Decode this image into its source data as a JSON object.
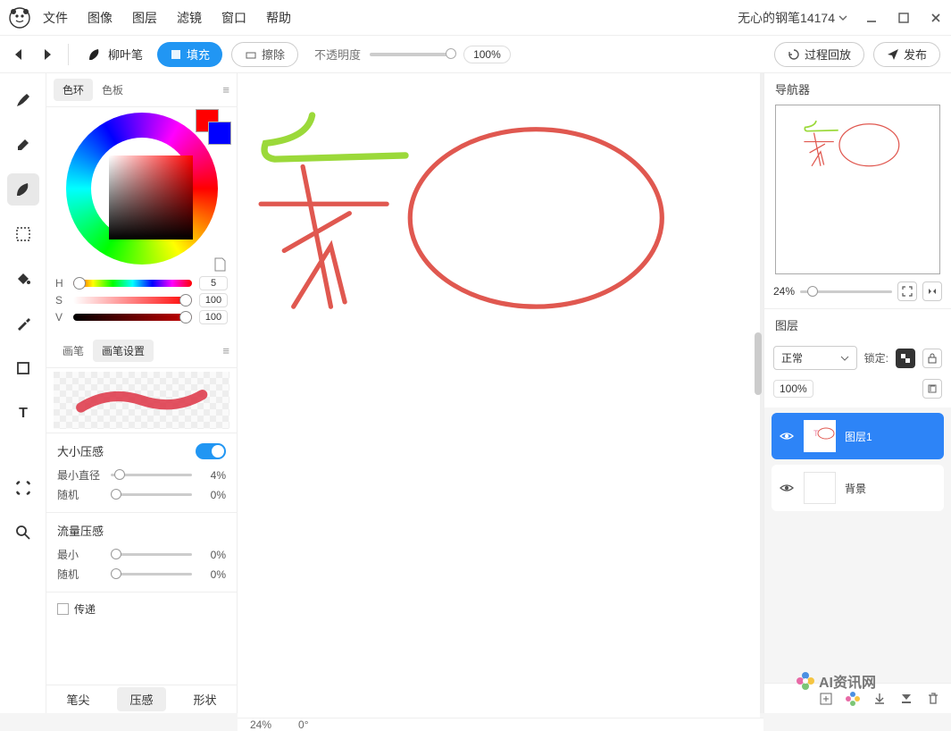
{
  "document": {
    "title": "无心的钢笔14174"
  },
  "menu": [
    "文件",
    "图像",
    "图层",
    "滤镜",
    "窗口",
    "帮助"
  ],
  "toolbar": {
    "brush_name": "柳叶笔",
    "fill": "填充",
    "erase": "擦除",
    "opacity_label": "不透明度",
    "opacity_value": "100%",
    "process_playback": "过程回放",
    "publish": "发布"
  },
  "tools": [
    "brush",
    "eraser",
    "leaf",
    "select",
    "bucket",
    "eyedropper",
    "shape",
    "text",
    "transform",
    "zoom"
  ],
  "active_tool": "leaf",
  "color_panel": {
    "tabs": [
      "色环",
      "色板"
    ],
    "active_tab": "色环",
    "hsv": {
      "h": 5,
      "s": 100,
      "v": 100
    },
    "foreground": "#ff0000",
    "background": "#0000ff"
  },
  "brush_panel": {
    "tabs": [
      "画笔",
      "画笔设置"
    ],
    "active_tab": "画笔设置",
    "size_pressure": {
      "label": "大小压感",
      "on": true,
      "min_diameter_label": "最小直径",
      "min_diameter": "4%",
      "random_label": "随机",
      "random": "0%"
    },
    "flow_pressure": {
      "label": "流量压感",
      "on": null,
      "min_label": "最小",
      "min": "0%",
      "random_label": "随机",
      "random": "0%"
    },
    "transfer_label": "传递",
    "bottom_tabs": [
      "笔尖",
      "压感",
      "形状"
    ],
    "active_bottom_tab": "压感"
  },
  "canvas": {
    "zoom": "24%",
    "rotation": "0°"
  },
  "navigator": {
    "title": "导航器",
    "zoom": "24%"
  },
  "layers_panel": {
    "title": "图层",
    "blend_mode": "正常",
    "lock_label": "锁定:",
    "opacity": "100%",
    "layers": [
      {
        "name": "图层1",
        "active": true,
        "visible": true
      },
      {
        "name": "背景",
        "active": false,
        "visible": true
      }
    ]
  },
  "watermark": "AI资讯网"
}
